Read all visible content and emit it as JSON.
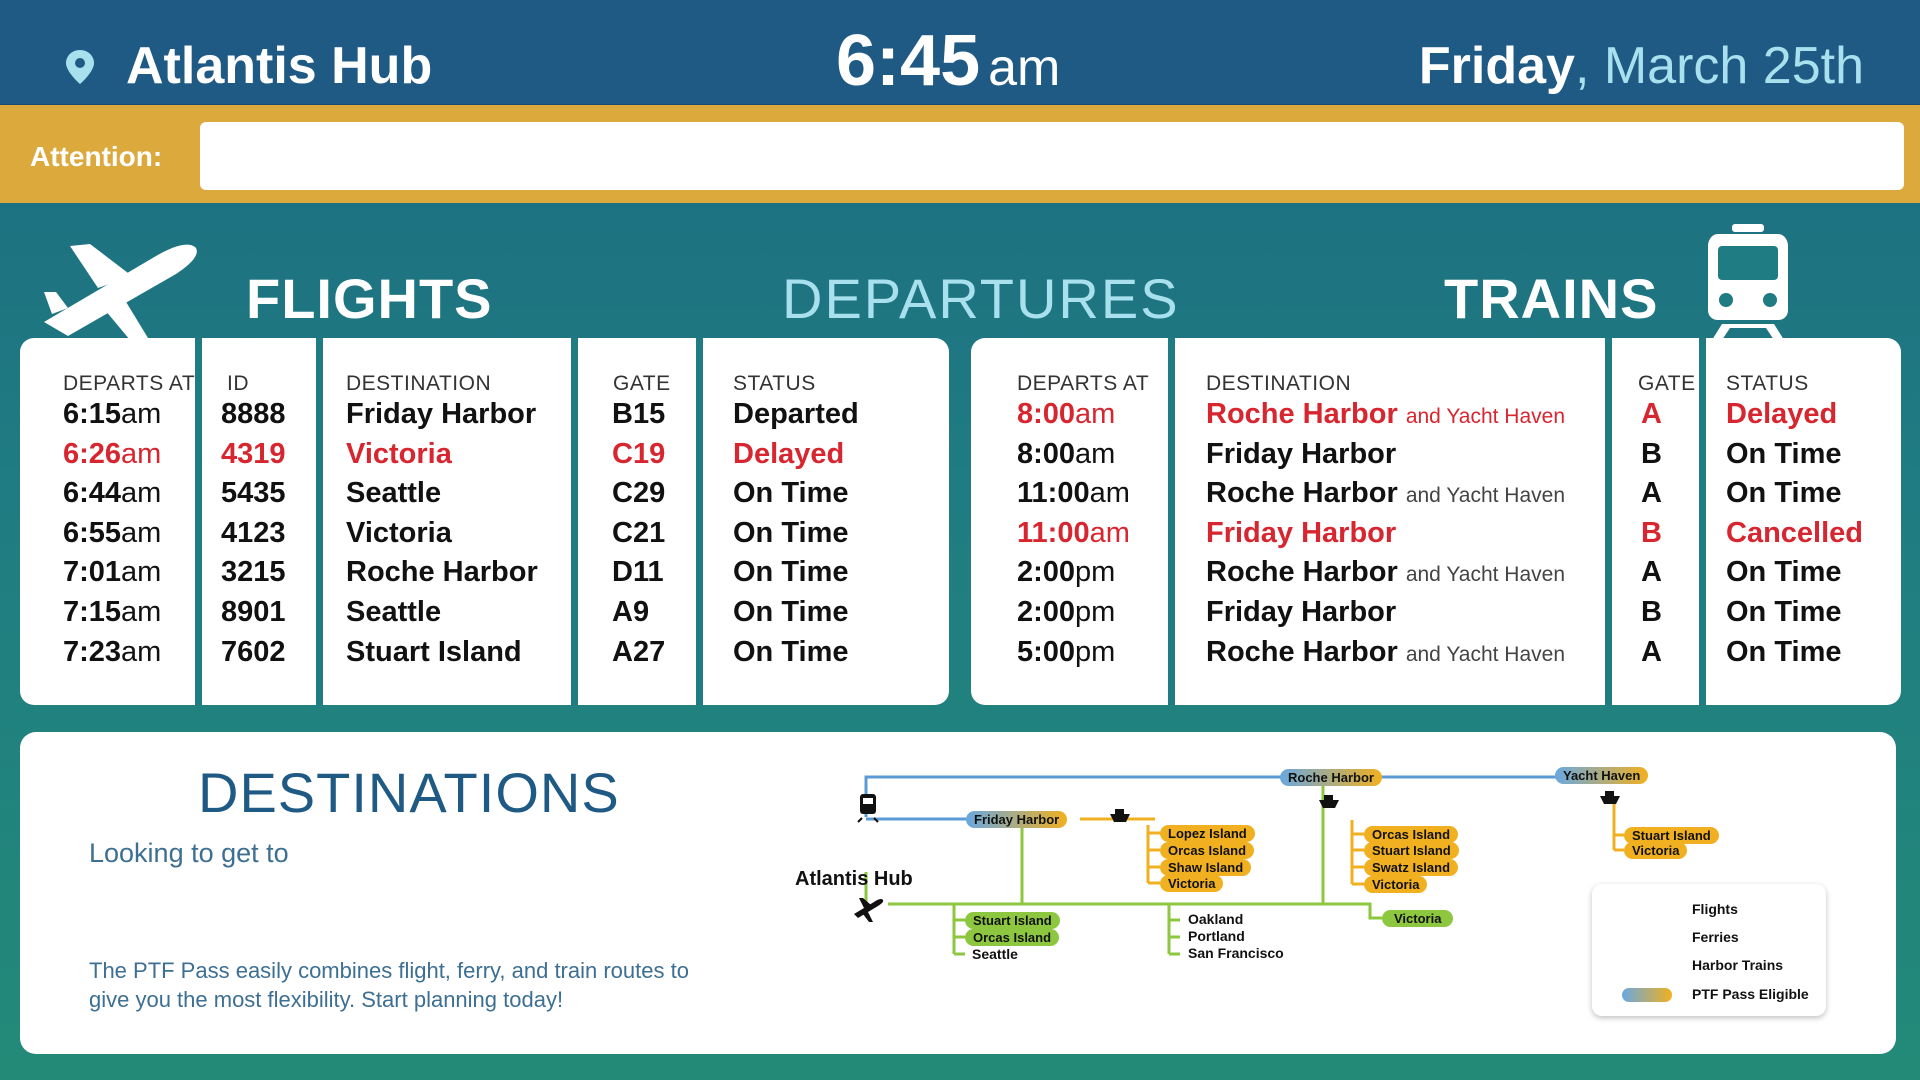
{
  "header": {
    "location": "Atlantis Hub",
    "time": "6:45",
    "ampm": "am",
    "day": "Friday",
    "date_rest": ", March 25th"
  },
  "attention": {
    "label": "Attention:",
    "message": ""
  },
  "sections": {
    "flights": "FLIGHTS",
    "departures": "DEPARTURES",
    "trains": "TRAINS"
  },
  "flights": {
    "headers": {
      "departs": "DEPARTS AT",
      "id": "ID",
      "destination": "DESTINATION",
      "gate": "GATE",
      "status": "STATUS"
    },
    "rows": [
      {
        "time": "6:15",
        "ampm": "am",
        "id": "8888",
        "destination": "Friday Harbor",
        "gate": "B15",
        "status": "Departed",
        "alert": false
      },
      {
        "time": "6:26",
        "ampm": "am",
        "id": "4319",
        "destination": "Victoria",
        "gate": "C19",
        "status": "Delayed",
        "alert": true
      },
      {
        "time": "6:44",
        "ampm": "am",
        "id": "5435",
        "destination": "Seattle",
        "gate": "C29",
        "status": "On Time",
        "alert": false
      },
      {
        "time": "6:55",
        "ampm": "am",
        "id": "4123",
        "destination": "Victoria",
        "gate": "C21",
        "status": "On Time",
        "alert": false
      },
      {
        "time": "7:01",
        "ampm": "am",
        "id": "3215",
        "destination": "Roche Harbor",
        "gate": "D11",
        "status": "On Time",
        "alert": false
      },
      {
        "time": "7:15",
        "ampm": "am",
        "id": "8901",
        "destination": "Seattle",
        "gate": "A9",
        "status": "On Time",
        "alert": false
      },
      {
        "time": "7:23",
        "ampm": "am",
        "id": "7602",
        "destination": "Stuart Island",
        "gate": "A27",
        "status": "On Time",
        "alert": false
      }
    ]
  },
  "trains": {
    "headers": {
      "departs": "DEPARTS AT",
      "destination": "DESTINATION",
      "gate": "GATE",
      "status": "STATUS"
    },
    "rows": [
      {
        "time": "8:00",
        "ampm": "am",
        "destination": "Roche Harbor",
        "extra": "and Yacht Haven",
        "gate": "A",
        "status": "Delayed",
        "alert": true
      },
      {
        "time": "8:00",
        "ampm": "am",
        "destination": "Friday Harbor",
        "extra": "",
        "gate": "B",
        "status": "On Time",
        "alert": false
      },
      {
        "time": "11:00",
        "ampm": "am",
        "destination": "Roche Harbor",
        "extra": "and Yacht Haven",
        "gate": "A",
        "status": "On Time",
        "alert": false
      },
      {
        "time": "11:00",
        "ampm": "am",
        "destination": "Friday Harbor",
        "extra": "",
        "gate": "B",
        "status": "Cancelled",
        "alert": true
      },
      {
        "time": "2:00",
        "ampm": "pm",
        "destination": "Roche Harbor",
        "extra": "and Yacht Haven",
        "gate": "A",
        "status": "On Time",
        "alert": false
      },
      {
        "time": "2:00",
        "ampm": "pm",
        "destination": "Friday Harbor",
        "extra": "",
        "gate": "B",
        "status": "On Time",
        "alert": false
      },
      {
        "time": "5:00",
        "ampm": "pm",
        "destination": "Roche Harbor",
        "extra": "and Yacht Haven",
        "gate": "A",
        "status": "On Time",
        "alert": false
      }
    ]
  },
  "destinations": {
    "title": "DESTINATIONS",
    "subtitle": "Looking to get to",
    "description": "The PTF Pass easily combines flight, ferry, and train routes to give you the most flexibility. Start planning today!",
    "map": {
      "hub": "Atlantis Hub",
      "roche_harbor": "Roche Harbor",
      "yacht_haven": "Yacht Haven",
      "friday_harbor": "Friday Harbor",
      "friday_ferry": [
        "Lopez Island",
        "Orcas Island",
        "Shaw Island",
        "Victoria"
      ],
      "roche_ferry": [
        "Orcas Island",
        "Stuart Island",
        "Swatz Island",
        "Victoria"
      ],
      "yacht_ferry": [
        "Stuart Island",
        "Victoria"
      ],
      "flight_group1": [
        "Stuart Island",
        "Orcas Island",
        "Seattle"
      ],
      "flight_group2": [
        "Oakland",
        "Portland",
        "San Francisco"
      ],
      "flight_victoria": "Victoria"
    },
    "legend": [
      "Flights",
      "Ferries",
      "Harbor Trains",
      "PTF Pass Eligible"
    ]
  },
  "colors": {
    "red": "#d7262f",
    "header_blue": "#1f5a85",
    "attention_gold": "#dcaa3c",
    "teal": "#1f7c82",
    "flight_green": "#8dc63f",
    "ferry_yellow": "#f0b020",
    "train_blue": "#5b9bd5"
  },
  "icons": [
    "location-pin-icon",
    "airplane-icon",
    "train-icon",
    "ferry-icon"
  ]
}
